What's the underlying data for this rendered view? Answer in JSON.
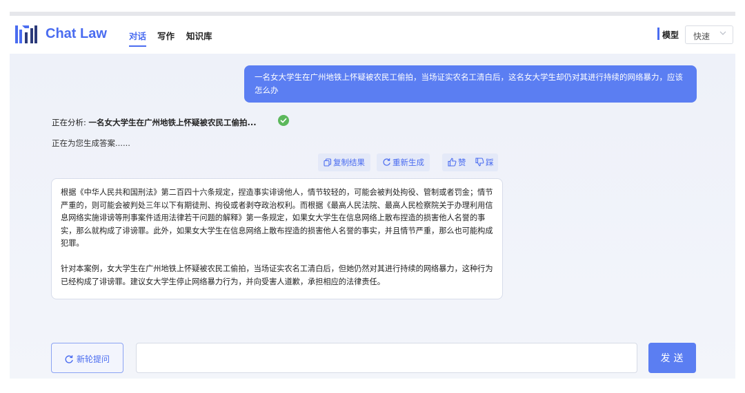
{
  "header": {
    "brand": "Chat Law",
    "tabs": [
      {
        "label": "对话",
        "active": true
      },
      {
        "label": "写作",
        "active": false
      },
      {
        "label": "知识库",
        "active": false
      }
    ],
    "model_label": "模型",
    "model_value": "快速"
  },
  "conversation": {
    "user_message": "一名女大学生在广州地铁上怀疑被农民工偷拍，当场证实农名工清白后，这名女大学生却仍对其进行持续的网络暴力，应该怎么办",
    "analyzing_prefix": "正在分析: ",
    "analyzing_title": "一名女大学生在广州地铁上怀疑被农民工偷拍...",
    "generating_text": "正在为您生成答案......",
    "actions": {
      "copy": "复制结果",
      "regenerate": "重新生成",
      "like": "赞",
      "dislike": "踩"
    },
    "answer_paragraphs": [
      "根据《中华人民共和国刑法》第二百四十六条规定，捏造事实诽谤他人，情节较轻的，可能会被判处拘役、管制或者罚金；情节严重的，则可能会被判处三年以下有期徒刑、拘役或者剥夺政治权利。而根据《最高人民法院、最高人民检察院关于办理利用信息网络实施诽谤等刑事案件适用法律若干问题的解释》第一条规定，如果女大学生在信息网络上散布捏造的损害他人名誉的事实，那么就构成了诽谤罪。此外，如果女大学生在信息网络上散布捏造的损害他人名誉的事实，并且情节严重，那么也可能构成犯罪。",
      "针对本案例，女大学生在广州地铁上怀疑被农民工偷拍，当场证实农名工清白后，但她仍然对其进行持续的网络暴力，这种行为已经构成了诽谤罪。建议女大学生停止网络暴力行为，并向受害人道歉，承担相应的法律责任。"
    ]
  },
  "footer": {
    "new_question": "新轮提问",
    "input_value": "",
    "send": "发送"
  },
  "colors": {
    "accent": "#4a6cf0",
    "user_bubble": "#5b7ef2",
    "check": "#5cb85c"
  },
  "icons": [
    "logo-icon",
    "check-circle-icon",
    "copy-icon",
    "refresh-icon",
    "thumbs-up-icon",
    "thumbs-down-icon",
    "chevron-down-icon"
  ]
}
